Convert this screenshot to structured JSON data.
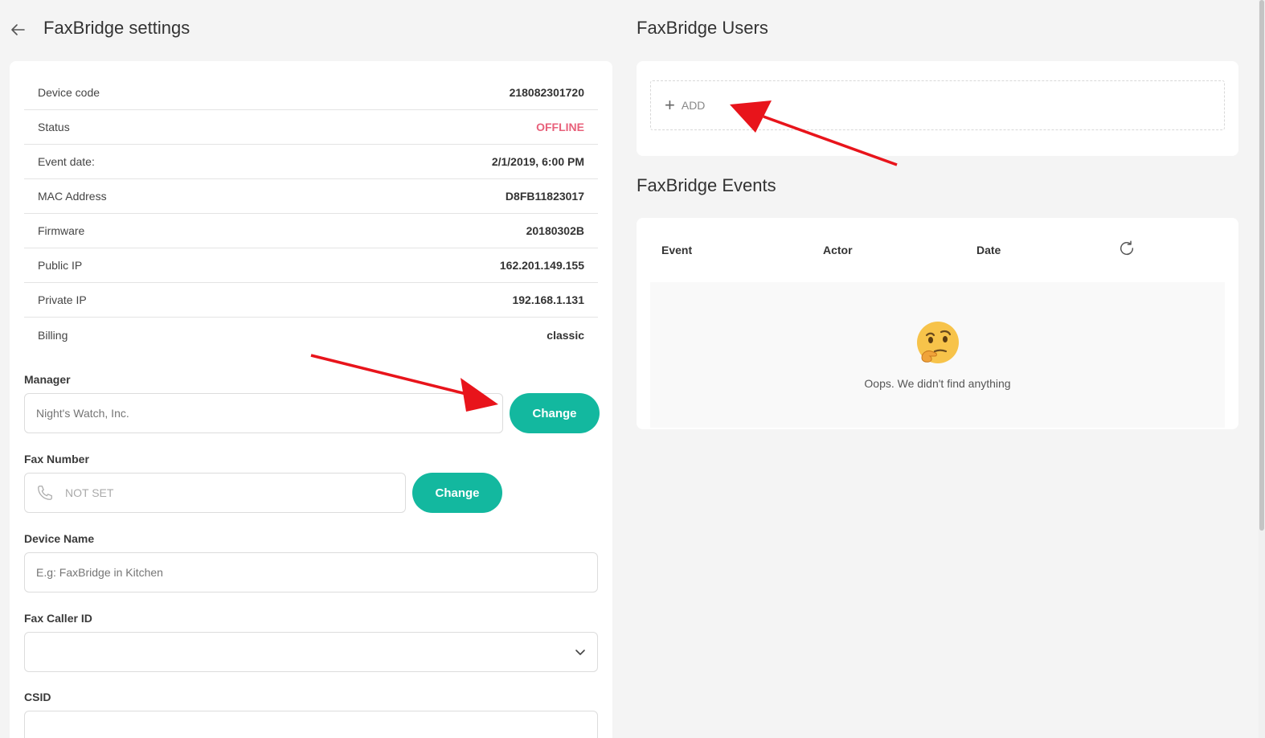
{
  "header": {
    "title": "FaxBridge settings"
  },
  "device_info": [
    {
      "label": "Device code",
      "value": "218082301720",
      "status": "normal"
    },
    {
      "label": "Status",
      "value": "OFFLINE",
      "status": "offline"
    },
    {
      "label": "Event date:",
      "value": "2/1/2019, 6:00 PM",
      "status": "normal"
    },
    {
      "label": "MAC Address",
      "value": "D8FB11823017",
      "status": "normal"
    },
    {
      "label": "Firmware",
      "value": "20180302B",
      "status": "normal"
    },
    {
      "label": "Public IP",
      "value": "162.201.149.155",
      "status": "normal"
    },
    {
      "label": "Private IP",
      "value": "192.168.1.131",
      "status": "normal"
    },
    {
      "label": "Billing",
      "value": "classic",
      "status": "normal"
    }
  ],
  "manager": {
    "label": "Manager",
    "placeholder": "Night's Watch, Inc.",
    "button": "Change"
  },
  "fax_number": {
    "label": "Fax Number",
    "placeholder": "NOT SET",
    "button": "Change",
    "icon": "phone-icon"
  },
  "device_name": {
    "label": "Device Name",
    "placeholder": "E.g: FaxBridge in Kitchen"
  },
  "fax_caller_id": {
    "label": "Fax Caller ID",
    "value": ""
  },
  "csid": {
    "label": "CSID",
    "value": ""
  },
  "users": {
    "title": "FaxBridge Users",
    "add_label": "ADD"
  },
  "events": {
    "title": "FaxBridge Events",
    "columns": [
      "Event",
      "Actor",
      "Date"
    ],
    "empty_text": "Oops. We didn't find anything"
  },
  "colors": {
    "accent": "#13b89f",
    "offline": "#e8607a",
    "annotation": "#e8141b"
  }
}
